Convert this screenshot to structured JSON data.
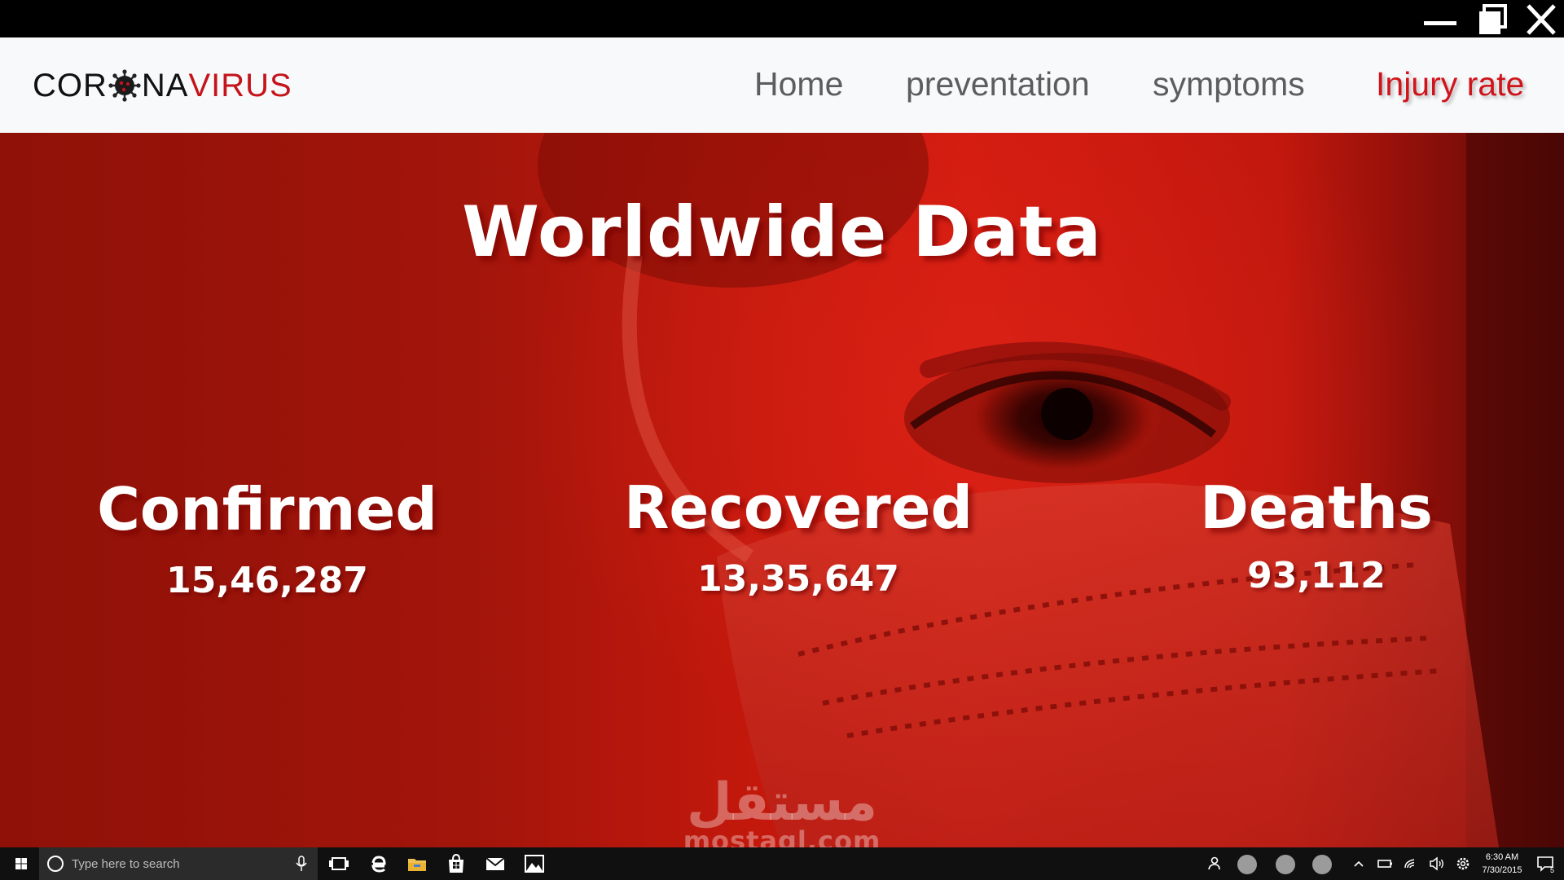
{
  "window": {
    "controls": [
      "minimize-icon",
      "maximize-icon",
      "close-icon"
    ]
  },
  "navbar": {
    "logo": {
      "part1": "COR",
      "part2": "NA",
      "part3": "VIRUS",
      "icon": "virus-icon"
    },
    "items": [
      {
        "label": "Home"
      },
      {
        "label": "preventation"
      },
      {
        "label": "symptoms"
      },
      {
        "label": "Injury rate",
        "active": true
      }
    ]
  },
  "hero": {
    "title": "Worldwide Data",
    "stats": [
      {
        "label": "Confirmed",
        "value": "15,46,287"
      },
      {
        "label": "Recovered",
        "value": "13,35,647"
      },
      {
        "label": "Deaths",
        "value": "93,112"
      }
    ],
    "watermark": {
      "arabic": "مستقل",
      "latin": "mostaql.com"
    }
  },
  "taskbar": {
    "search_placeholder": "Type here to search",
    "time": "6:30 AM",
    "date": "7/30/2015",
    "notification_count": "5"
  },
  "colors": {
    "accent": "#d0141c",
    "nav_text": "#5d5d5d",
    "navbar_bg": "#f8f9fb",
    "hero_red": "#c3180c"
  }
}
